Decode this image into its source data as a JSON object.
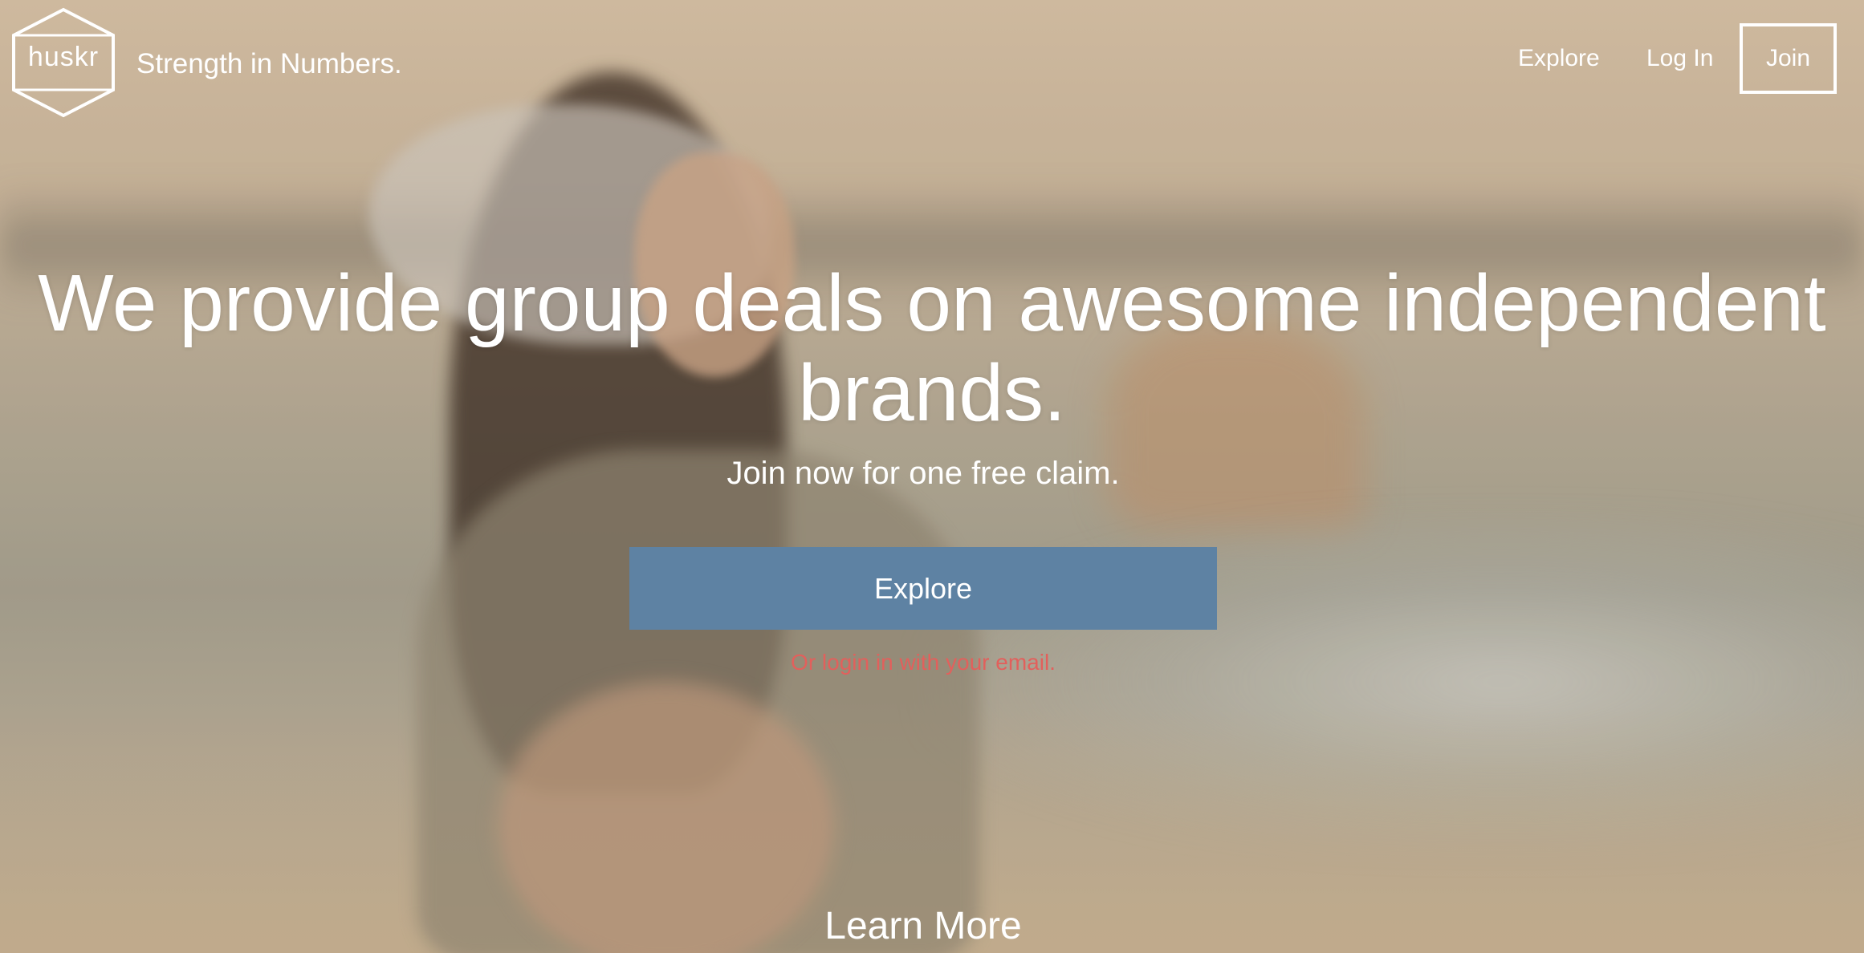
{
  "header": {
    "logo_text": "huskr",
    "tagline": "Strength in Numbers.",
    "nav": {
      "explore": "Explore",
      "login": "Log In",
      "join": "Join"
    }
  },
  "hero": {
    "headline": "We provide group deals on awesome independent brands.",
    "subhead": "Join now for one free claim.",
    "cta_label": "Explore",
    "email_login": "Or login in with your email.",
    "learn_more": "Learn More"
  },
  "colors": {
    "cta_background": "#5e82a3",
    "email_link": "#e2605c",
    "text": "#ffffff"
  }
}
